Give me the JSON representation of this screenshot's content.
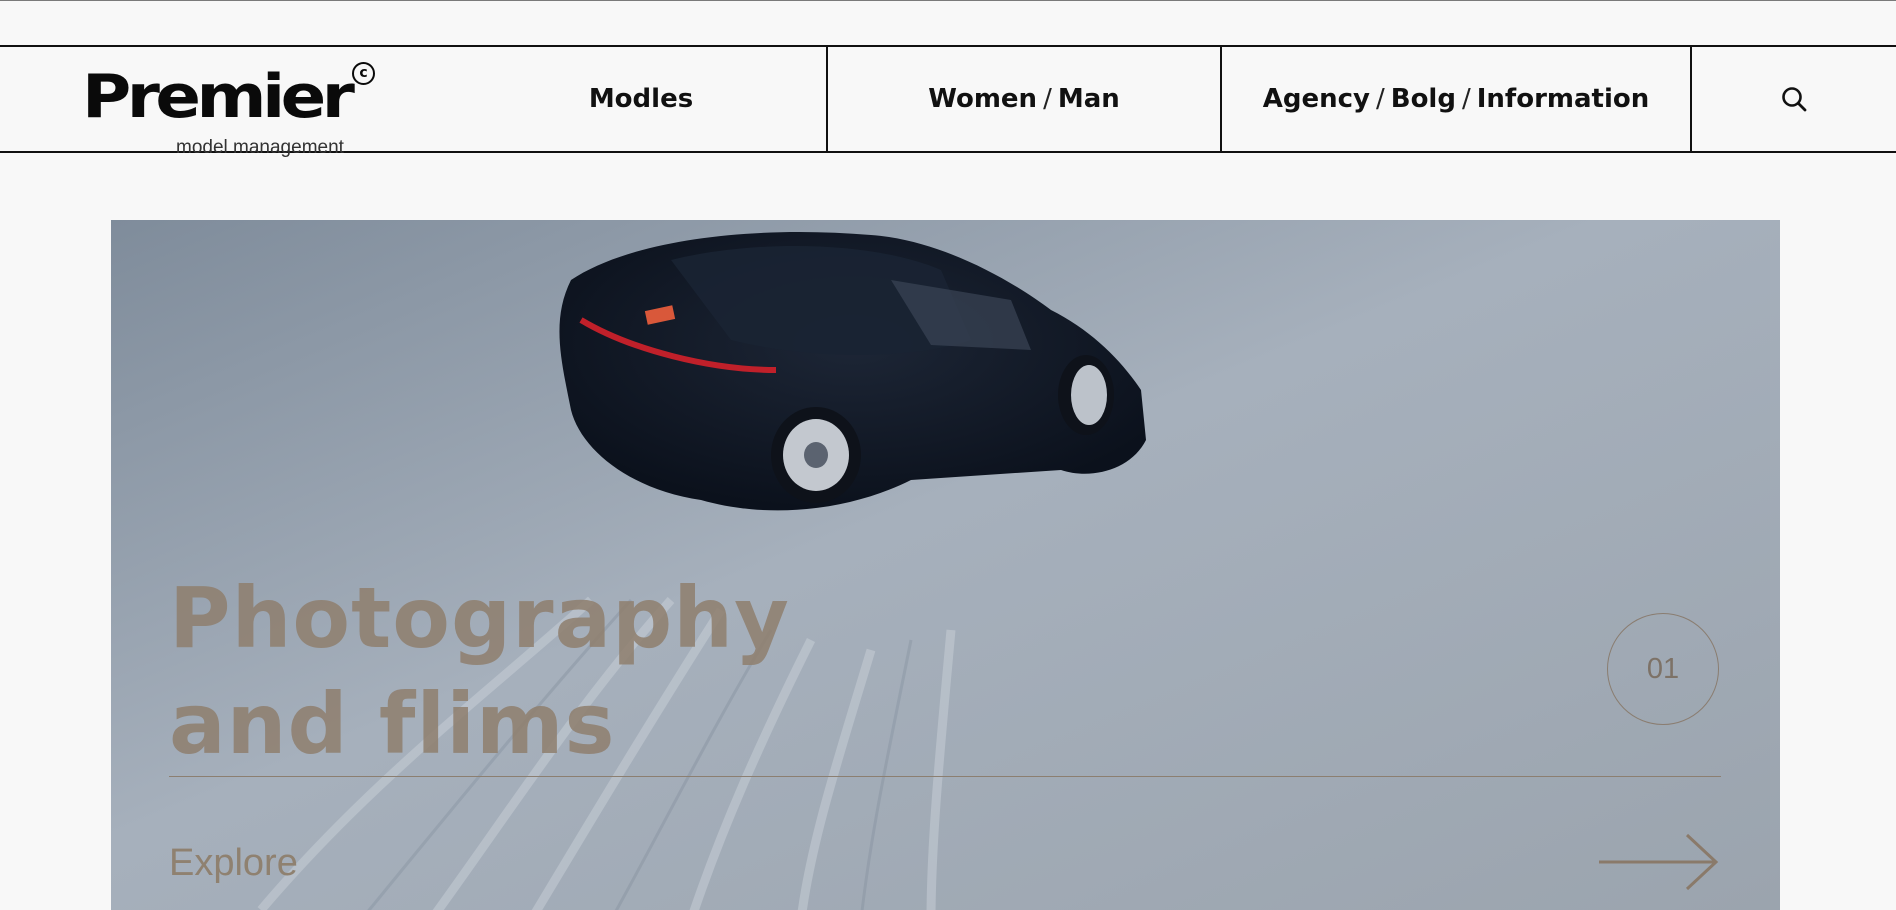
{
  "brand": {
    "name": "Premier",
    "mark": "c",
    "tagline": "model management"
  },
  "nav": {
    "models": "Modles",
    "women": "Women",
    "men": "Man",
    "agency": "Agency",
    "blog": "Bolg",
    "information": "Information",
    "separator": "/",
    "search_icon": "search-icon"
  },
  "hero": {
    "title_line1": "Photography",
    "title_line2": "and flims",
    "slide_number": "01",
    "cta": "Explore",
    "arrow_icon": "arrow-right-icon"
  },
  "colors": {
    "background": "#f8f8f8",
    "text": "#111111",
    "accent": "#8f7f6e"
  }
}
